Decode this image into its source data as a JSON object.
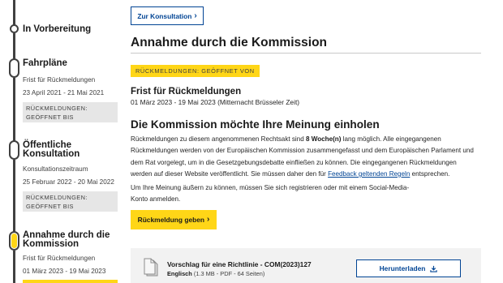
{
  "timeline": {
    "stage_prep": {
      "title": "In Vorbereitung"
    },
    "stage_roadmaps": {
      "title": "Fahrpläne",
      "sub_label": "Frist für Rückmeldungen",
      "dates": "23 April 2021 - 21 Mai 2021",
      "badge_line1": "RÜCKMELDUNGEN:",
      "badge_line2": "GEÖFFNET BIS"
    },
    "stage_consultation": {
      "title_line1": "Öffentliche",
      "title_line2": "Konsultation",
      "sub_label": "Konsultationszeitraum",
      "dates": "25 Februar 2022 - 20 Mai 2022",
      "badge_line1": "RÜCKMELDUNGEN:",
      "badge_line2": "GEÖFFNET BIS"
    },
    "stage_adoption": {
      "title_line1": "Annahme durch die",
      "title_line2": "Kommission",
      "sub_label": "Frist für Rückmeldungen",
      "dates": "01 März 2023 - 19 Mai 2023"
    }
  },
  "header": {
    "back_button_label": "Zur Konsultation",
    "page_title": "Annahme durch die Kommission"
  },
  "status": {
    "badge": "RÜCKMELDUNGEN: GEÖFFNET VON"
  },
  "deadline": {
    "title": "Frist für Rückmeldungen",
    "dates": "01 März 2023 - 19 Mai 2023  (Mitternacht Brüsseler Zeit)"
  },
  "opinion": {
    "heading": "Die Kommission möchte Ihre Meinung einholen",
    "p1_part1": "Rückmeldungen zu diesem angenommenen Rechtsakt sind ",
    "p1_bold": "8 Woche(n)",
    "p1_part2": " lang möglich. Alle eingegangenen",
    "p1_line2": "Rückmeldungen werden von der Europäischen Kommission zusammengefasst und dem Europäischen Parlament und",
    "p1_line3": "dem Rat vorgelegt, um in die Gesetzgebungsdebatte einfließen zu können. Die eingegangenen Rückmeldungen",
    "p1_line4_part1": "werden auf dieser Website veröffentlicht. Sie müssen daher den für ",
    "p1_link": "Feedback geltenden Regeln",
    "p1_line4_part2": " entsprechen.",
    "p2_line1": "Um Ihre Meinung äußern zu können, müssen Sie sich registrieren oder mit einem Social-Media-",
    "p2_line2": "Konto anmelden.",
    "feedback_button_label": "Rückmeldung geben"
  },
  "document": {
    "title": "Vorschlag für eine Richtlinie - COM(2023)127",
    "language": "Englisch",
    "meta": " (1.3 MB - PDF - 64 Seiten)",
    "download_button_label": "Herunterladen",
    "icon": "document-icon"
  },
  "colors": {
    "accent_yellow": "#ffd617",
    "link_blue": "#004494",
    "timeline_gray": "#404040",
    "badge_gray": "#e6e6e6",
    "card_bg": "#f2f2f2"
  }
}
